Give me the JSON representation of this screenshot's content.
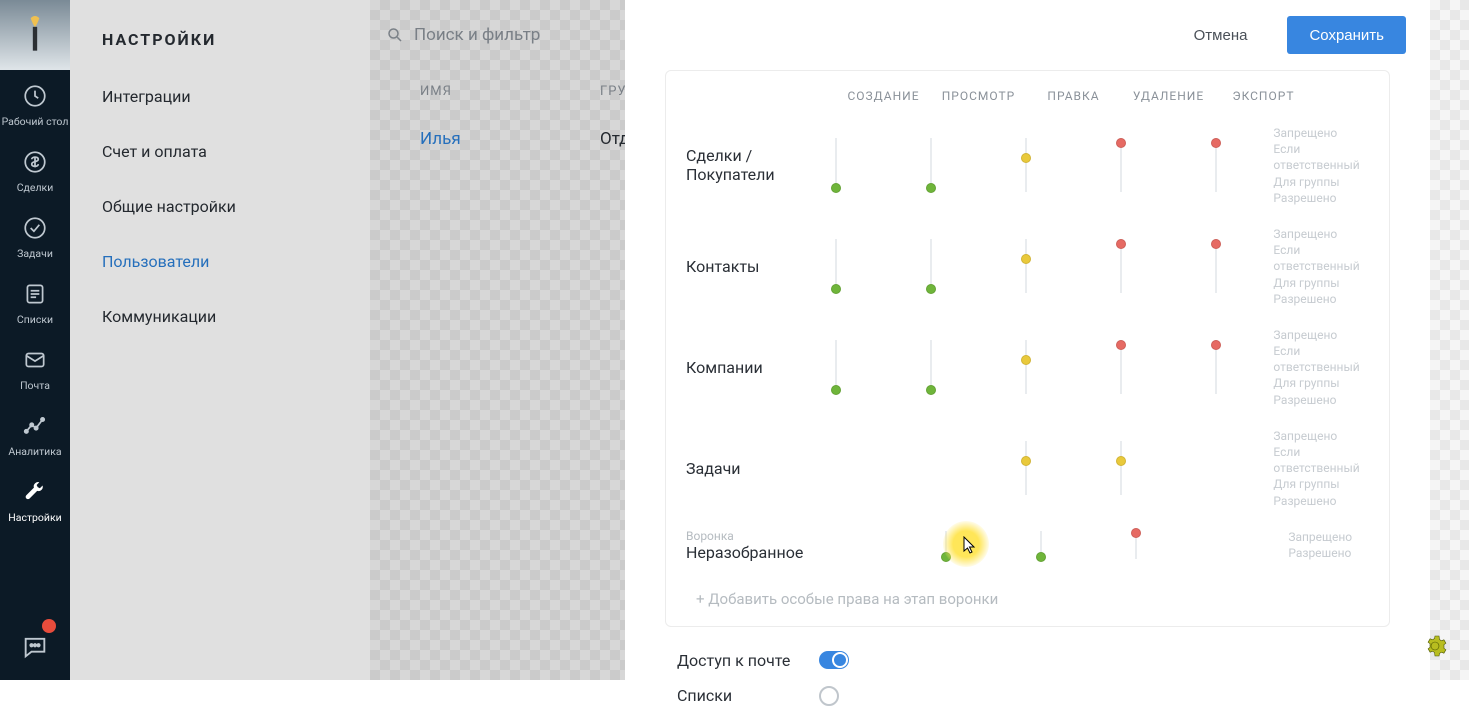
{
  "rail": {
    "items": [
      {
        "label": "Рабочий стол"
      },
      {
        "label": "Сделки"
      },
      {
        "label": "Задачи"
      },
      {
        "label": "Списки"
      },
      {
        "label": "Почта"
      },
      {
        "label": "Аналитика"
      },
      {
        "label": "Настройки"
      }
    ],
    "chat_badge": ""
  },
  "settings": {
    "title": "НАСТРОЙКИ",
    "items": [
      "Интеграции",
      "Счет и оплата",
      "Общие настройки",
      "Пользователи",
      "Коммуникации"
    ],
    "active_index": 3
  },
  "toolbar": {
    "search_placeholder": "Поиск и фильтр"
  },
  "table": {
    "col_name": "ИМЯ",
    "col_group": "ГРУППА",
    "row_name": "Илья",
    "row_group": "Отдел"
  },
  "panel": {
    "cancel": "Отмена",
    "save": "Сохранить",
    "columns": [
      "СОЗДАНИЕ",
      "ПРОСМОТР",
      "ПРАВКА",
      "УДАЛЕНИЕ",
      "ЭКСПОРТ"
    ],
    "legend": [
      "Запрещено",
      "Если ответственный",
      "Для группы",
      "Разрешено"
    ],
    "legend_short": [
      "Запрещено",
      "Разрешено"
    ],
    "rows": [
      {
        "label": "Сделки / Покупатели",
        "sup": "",
        "cells": [
          "bot-green",
          "bot-green",
          "midhigh-yellow",
          "toptop-red",
          "toptop-red"
        ],
        "legend": "full"
      },
      {
        "label": "Контакты",
        "sup": "",
        "cells": [
          "bot-green",
          "bot-green",
          "midhigh-yellow",
          "toptop-red",
          "toptop-red"
        ],
        "legend": "full"
      },
      {
        "label": "Компании",
        "sup": "",
        "cells": [
          "bot-green",
          "bot-green",
          "midhigh-yellow",
          "toptop-red",
          "toptop-red"
        ],
        "legend": "full"
      },
      {
        "label": "Задачи",
        "sup": "",
        "cells": [
          "",
          "",
          "midhigh-yellow",
          "midhigh-yellow",
          ""
        ],
        "legend": "full"
      },
      {
        "label": "Неразобранное",
        "sup": "Воронка",
        "cells": [
          "",
          "bot-green",
          "bot-green",
          "toptop-red",
          ""
        ],
        "legend": "short",
        "short": true
      }
    ],
    "add_link": "+  Добавить особые права на этап воронки",
    "toggle_mail": "Доступ к почте",
    "toggle_lists": "Списки"
  },
  "colors": {
    "green": "#6fb53a",
    "yellow": "#e9c93b",
    "red": "#e66a63"
  }
}
